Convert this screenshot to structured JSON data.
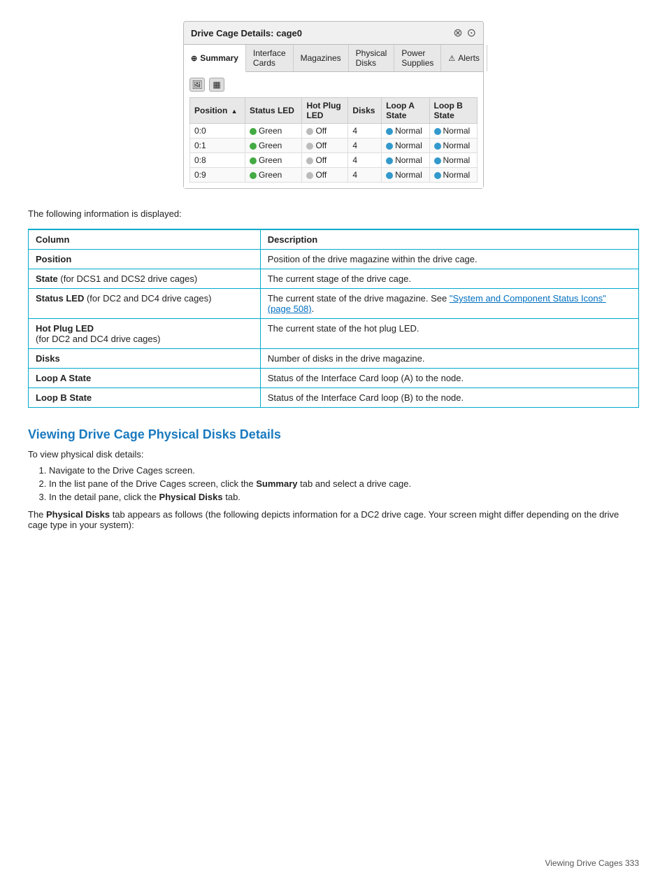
{
  "panel": {
    "title": "Drive Cage Details: cage0",
    "icons": [
      "⊗",
      "⊙"
    ],
    "tabs": [
      {
        "label": "Summary",
        "icon": "⊕",
        "active": false
      },
      {
        "label": "Interface Cards",
        "active": false
      },
      {
        "label": "Magazines",
        "active": true
      },
      {
        "label": "Physical Disks",
        "active": false
      },
      {
        "label": "Power Supplies",
        "active": false
      },
      {
        "label": "Alerts",
        "icon": "⚠",
        "active": false
      }
    ],
    "toolbar": {
      "btn1": "🖼",
      "btn2": "▦"
    },
    "table": {
      "columns": [
        {
          "label": "Position",
          "sort": true
        },
        {
          "label": "Status LED"
        },
        {
          "label": "Hot Plug LED"
        },
        {
          "label": "Disks"
        },
        {
          "label": "Loop A State"
        },
        {
          "label": "Loop B State"
        }
      ],
      "rows": [
        {
          "position": "0:0",
          "status_led": "Green",
          "hot_plug": "Off",
          "disks": "4",
          "loop_a": "Normal",
          "loop_b": "Normal"
        },
        {
          "position": "0:1",
          "status_led": "Green",
          "hot_plug": "Off",
          "disks": "4",
          "loop_a": "Normal",
          "loop_b": "Normal"
        },
        {
          "position": "0:8",
          "status_led": "Green",
          "hot_plug": "Off",
          "disks": "4",
          "loop_a": "Normal",
          "loop_b": "Normal"
        },
        {
          "position": "0:9",
          "status_led": "Green",
          "hot_plug": "Off",
          "disks": "4",
          "loop_a": "Normal",
          "loop_b": "Normal"
        }
      ]
    }
  },
  "info_section": {
    "intro": "The following information is displayed:",
    "table": {
      "col1_header": "Column",
      "col2_header": "Description",
      "rows": [
        {
          "col1": "Position",
          "col1_bold": true,
          "col2": "Position of the drive magazine within the drive cage."
        },
        {
          "col1": "State (for DCS1 and DCS2 drive cages)",
          "col1_bold": true,
          "col1_bold_part": "State",
          "col1_rest": " (for DCS1 and DCS2 drive cages)",
          "col2": "The current stage of the drive cage."
        },
        {
          "col1": "Status LED (for DC2 and DC4 drive cages)",
          "col1_bold_part": "Status LED",
          "col1_rest": " (for DC2 and DC4 drive cages)",
          "col2_pre": "The current state of the drive magazine. See ",
          "col2_link": "\"System and Component Status Icons\" (page 508)",
          "col2_post": "."
        },
        {
          "col1": "Hot Plug LED\n(for DC2 and DC4 drive cages)",
          "col1_bold_part": "Hot Plug LED",
          "col1_rest": "\n(for DC2 and DC4 drive cages)",
          "col2": "The current state of the hot plug LED."
        },
        {
          "col1": "Disks",
          "col1_bold": true,
          "col2": "Number of disks in the drive magazine."
        },
        {
          "col1": "Loop A State",
          "col1_bold": true,
          "col2": "Status of the Interface Card loop (A) to the node."
        },
        {
          "col1": "Loop B State",
          "col1_bold": true,
          "col2": "Status of the Interface Card loop (B) to the node."
        }
      ]
    }
  },
  "viewing_section": {
    "heading": "Viewing Drive Cage Physical Disks Details",
    "intro": "To view physical disk details:",
    "steps": [
      "Navigate to the Drive Cages screen.",
      "In the list pane of the Drive Cages screen, click the Summary tab and select a drive cage.",
      "In the detail pane, click the Physical Disks tab."
    ],
    "outro_pre": "The ",
    "outro_bold": "Physical Disks",
    "outro_post": " tab appears as follows (the following depicts information for a DC2 drive cage. Your screen might differ depending on the drive cage type in your system):"
  },
  "footer": {
    "text": "Viewing Drive Cages   333"
  }
}
